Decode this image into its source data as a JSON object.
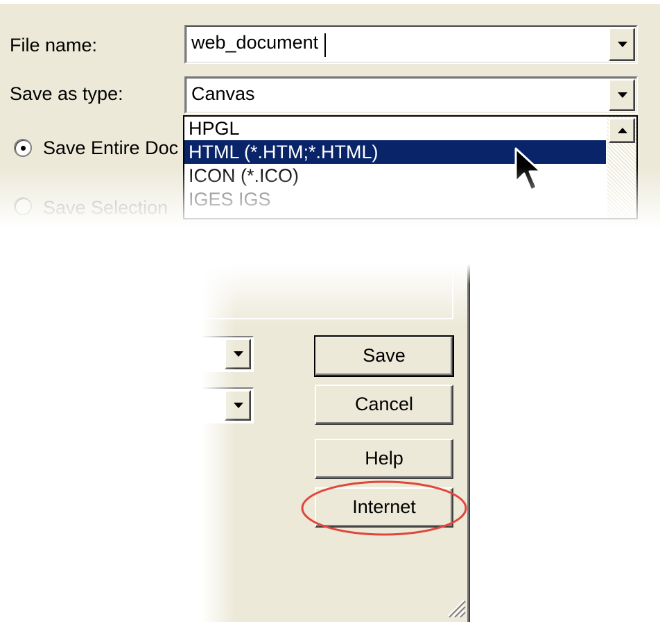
{
  "dialog": {
    "file_name_label": "File name:",
    "file_name_value": "web_document",
    "save_as_type_label": "Save as type:",
    "save_as_type_value": "Canvas",
    "type_options": [
      "HPGL",
      "HTML (*.HTM;*.HTML)",
      "ICON (*.ICO)",
      "IGES IGS"
    ],
    "selected_option": "HTML (*.HTM;*.HTML)",
    "radio_entire": "Save Entire Doc",
    "radio_selection": "Save Selection",
    "buttons": {
      "save": "Save",
      "cancel": "Cancel",
      "help": "Help",
      "internet": "Internet"
    }
  },
  "colors": {
    "dialog_face": "#ece9d8",
    "selection_highlight": "#0a246a",
    "annotation_circle": "#e0463c"
  },
  "icons": [
    "chevron-down-icon",
    "chevron-up-icon",
    "mouse-pointer-icon",
    "resize-grip-icon"
  ]
}
